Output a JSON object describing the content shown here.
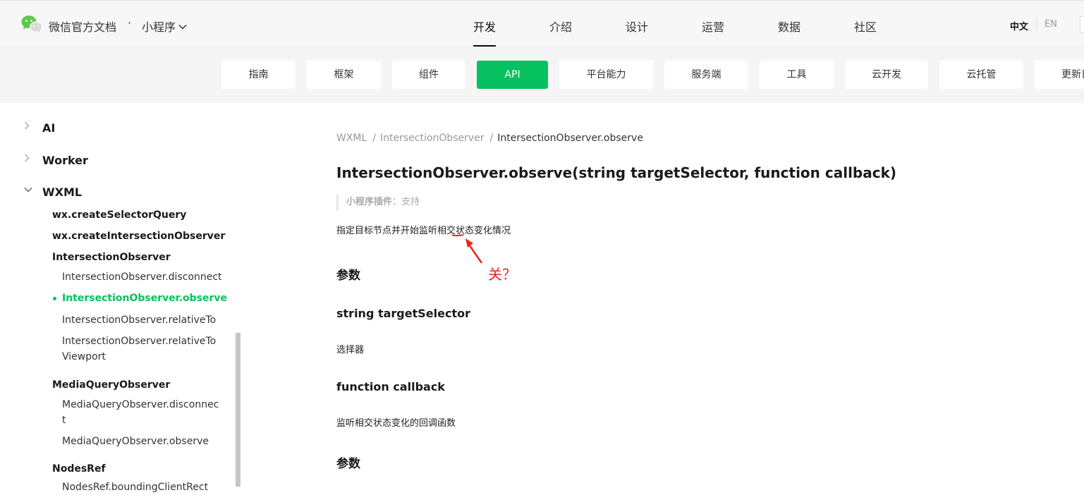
{
  "header": {
    "site_title": "微信官方文档",
    "site_dot": "·",
    "section": "小程序",
    "nav": [
      "开发",
      "介绍",
      "设计",
      "运营",
      "数据",
      "社区"
    ],
    "lang_zh": "中文",
    "lang_en": "EN"
  },
  "subnav": {
    "tabs": [
      "指南",
      "框架",
      "组件",
      "API",
      "平台能力",
      "服务端",
      "工具",
      "云开发",
      "云托管",
      "更新日志"
    ],
    "active_tab": "API"
  },
  "sidebar": {
    "top_items": [
      "AI",
      "Worker",
      "WXML"
    ],
    "wxml_children": [
      "wx.createSelectorQuery",
      "wx.createIntersectionObserver",
      "IntersectionObserver",
      "IntersectionObserver.disconnect",
      "IntersectionObserver.observe",
      "IntersectionObserver.relativeTo",
      "IntersectionObserver.relativeTo",
      "Viewport",
      "MediaQueryObserver",
      "MediaQueryObserver.disconnec",
      "t",
      "MediaQueryObserver.observe",
      "NodesRef",
      "NodesRef.boundingClientRect"
    ],
    "active_item": "IntersectionObserver.observe"
  },
  "content": {
    "breadcrumb": [
      "WXML",
      "IntersectionObserver",
      "IntersectionObserver.observe"
    ],
    "breadcrumb_sep": "/",
    "title": "IntersectionObserver.observe(string targetSelector, function callback)",
    "support_label": "小程序插件",
    "support_value": "：支持",
    "description": "指定目标节点并开始监听相交状态变化情况",
    "section_params": "参数",
    "param1_name": "string targetSelector",
    "param1_desc": "选择器",
    "param2_name": "function callback",
    "param2_desc": "监听相交状态变化的回调函数",
    "section_params2": "参数"
  },
  "annotation": {
    "text": "关？",
    "color": "#e8251e"
  },
  "colors": {
    "accent": "#07c160",
    "header_bg": "#f7f7f7",
    "subnav_bg": "#f5f5f5"
  },
  "icons": {
    "logo": "wechat-logo-icon",
    "section_dropdown": "chevron-down-icon",
    "tree_collapsed": "chevron-right-icon",
    "tree_expanded": "chevron-down-icon"
  }
}
